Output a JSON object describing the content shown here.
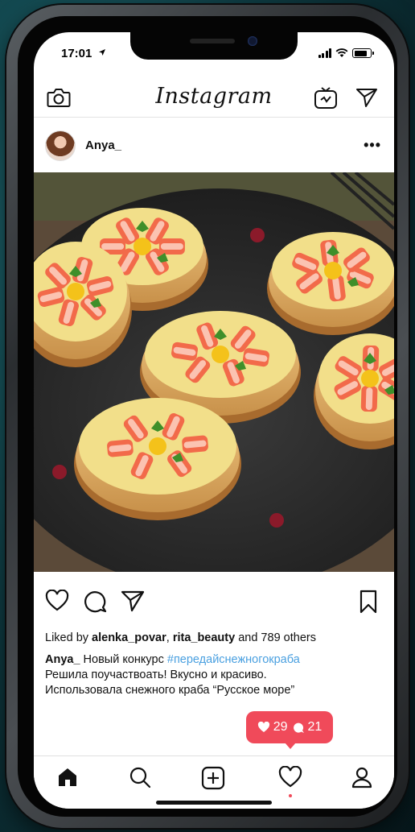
{
  "status": {
    "time": "17:01"
  },
  "topbar": {
    "logo": "Instagram"
  },
  "post": {
    "username": "Anya_",
    "more": "•••",
    "liked_prefix": "Liked by ",
    "liked_user1": "alenka_povar",
    "liked_sep": ", ",
    "liked_user2": "rita_beauty",
    "liked_suffix": " and 789 others",
    "caption_user": "Anya_",
    "caption_text1": " Новый конкурс ",
    "caption_hashtag": "#передайснежногокраба",
    "caption_line2": "Решила поучаствоать! Вкусно и красиво.",
    "caption_line3": "Использовала снежного краба “Русское море”"
  },
  "notification": {
    "likes": "29",
    "comments": "21"
  },
  "icons": {
    "camera": "camera-icon",
    "igtv": "igtv-icon",
    "send": "send-icon",
    "heart": "heart-icon",
    "comment": "comment-icon",
    "share": "share-icon",
    "bookmark": "bookmark-icon",
    "home": "home-icon",
    "search": "search-icon",
    "add": "add-icon",
    "activity": "activity-icon",
    "profile": "profile-icon"
  },
  "colors": {
    "notification": "#f04a5a",
    "hashtag": "#4aa0e0"
  }
}
